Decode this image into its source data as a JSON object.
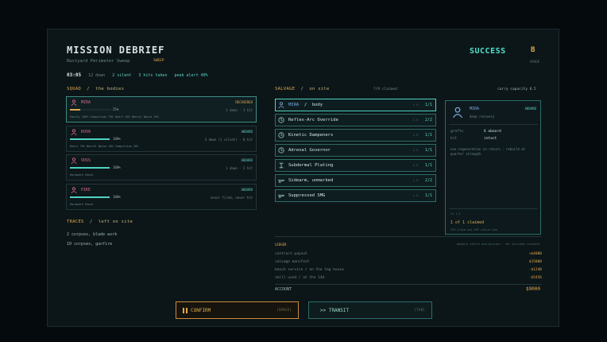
{
  "header": {
    "title": "MISSION DEBRIEF",
    "subtitle": "Rustyard Perimeter Sweep",
    "tag": "SWEEP",
    "time": "03:05",
    "stat_downs": "12 down",
    "stat_silent": "2 silent",
    "stat_hits": "3 hits taken",
    "stat_alert": "peak alert 40%",
    "result": "SUCCESS",
    "grade": "B",
    "grade_label": "GRADE"
  },
  "squad": {
    "header": "SQUAD",
    "subheader": "the bodies",
    "members": [
      {
        "name": "MIRA",
        "status": "RECOVERED",
        "health_pct": 25,
        "health": "25%",
        "wounds": "1 down · 1 hit",
        "traits": "Vanity 100%   Compulsion 70%   Heart 40%   Neural Noise 20%",
        "color": "#d46a8a"
      },
      {
        "name": "KOVA",
        "status": "ABOARD",
        "health_pct": 100,
        "health": "100%",
        "wounds": "3 down (1 silent) · 0 hit",
        "traits": "Heart 70%   Neural Noise 40%   Compulsion 20%",
        "color": "#d46a8a"
      },
      {
        "name": "VOSS",
        "status": "ABOARD",
        "health_pct": 100,
        "health": "100%",
        "wounds": "1 down · 2 hit",
        "traits": "Hardware Shock",
        "color": "#d46a8a"
      },
      {
        "name": "PIKE",
        "status": "ABOARD",
        "health_pct": 100,
        "health": "100%",
        "wounds": "never fired, never hit",
        "traits": "Hardware Shock",
        "color": "#d46a8a"
      }
    ]
  },
  "traces": {
    "header": "TRACES",
    "subheader": "left on site",
    "lines": [
      "2 corpses, blade work",
      "10 corpses, gunfire"
    ]
  },
  "salvage": {
    "header": "SALVAGE",
    "subheader": "on site",
    "claimed": "7/9 claimed",
    "capacity": "carry capacity 6.5",
    "items": [
      {
        "label": "MIRA",
        "sub": "body",
        "weight": "1.5",
        "count": "1/1",
        "icon": "person-icon"
      },
      {
        "label": "Reflex-Arc Override",
        "weight": "1.5",
        "count": "2/2",
        "icon": "clock-icon"
      },
      {
        "label": "Kinetic Dampeners",
        "weight": "1.5",
        "count": "1/1",
        "icon": "clock-icon"
      },
      {
        "label": "Adrenal Governor",
        "weight": "1.5",
        "count": "1/1",
        "icon": "clock-icon"
      },
      {
        "label": "Subdermal Plating",
        "weight": "1.5",
        "count": "1/1",
        "icon": "plate-icon"
      },
      {
        "label": "Sidearm, unmarked",
        "weight": "1.5",
        "count": "2/2",
        "icon": "gun-icon"
      },
      {
        "label": "Suppressed SMG",
        "weight": "1.5",
        "count": "1/1",
        "icon": "gun-icon"
      }
    ]
  },
  "detail": {
    "name": "MIRA",
    "status": "ABOARD",
    "desc": "deep recovery",
    "row1_k": "grafts",
    "row1_v": "6 aboard",
    "row2_k": "kit",
    "row2_v": "intact",
    "note": "non-regeneration on return · rebuild at quarter strength",
    "footer_small": "x1 1.5",
    "footer": "1 of 1 claimed",
    "footer_hint": "CLR claim one   SHF return one"
  },
  "ledger": {
    "header": "LEDGER",
    "hint": "amounts settle end-mission  ·  net includes transfer",
    "rows": [
      {
        "label": "contract payout",
        "value": "+$4000"
      },
      {
        "label": "salvage manifest",
        "value": "$15000"
      },
      {
        "label": "bench service  /  on the tag house",
        "value": "-$1240"
      },
      {
        "label": "skill used  /  at the 14A",
        "value": "-$5456"
      }
    ],
    "account_label": "ACCOUNT",
    "account_value": "$9000"
  },
  "buttons": {
    "confirm": "CONFIRM",
    "confirm_key": "[SPACE]",
    "transit": ">> TRANSIT",
    "transit_key": "[TAB]"
  },
  "colors": {
    "accent": "#4fd3c1",
    "warn": "#e0a94a",
    "panel": "#0c1619"
  }
}
